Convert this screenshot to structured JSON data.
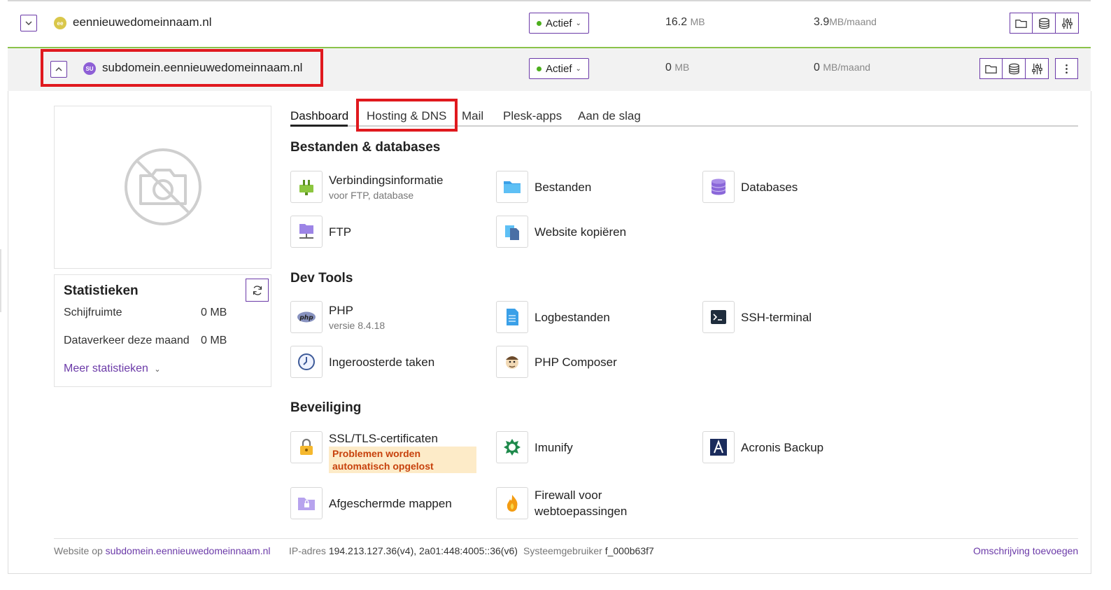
{
  "domains": [
    {
      "name": "eennieuwedomeinnaam.nl",
      "icon_text": "ee",
      "icon_color": "#d9c74a",
      "status": "Actief",
      "disk_value": "16.2",
      "disk_unit": "MB",
      "traffic_value": "3.9",
      "traffic_unit": "MB/maand"
    },
    {
      "name": "subdomein.eennieuwedomeinnaam.nl",
      "icon_text": "SU",
      "icon_color": "#8e5fd6",
      "status": "Actief",
      "disk_value": "0",
      "disk_unit": "MB",
      "traffic_value": "0",
      "traffic_unit": "MB/maand"
    }
  ],
  "stats": {
    "title": "Statistieken",
    "disk_label": "Schijfruimte",
    "disk_value": "0 MB",
    "traffic_label": "Dataverkeer deze maand",
    "traffic_value": "0 MB",
    "more_link": "Meer statistieken"
  },
  "tabs": [
    "Dashboard",
    "Hosting & DNS",
    "Mail",
    "Plesk-apps",
    "Aan de slag"
  ],
  "active_tab": "Dashboard",
  "sections": {
    "files": {
      "title": "Bestanden & databases",
      "items": [
        {
          "label": "Verbindingsinformatie",
          "sub": "voor FTP, database",
          "icon": "plug-icon"
        },
        {
          "label": "Bestanden",
          "icon": "folder-icon"
        },
        {
          "label": "Databases",
          "icon": "database-icon"
        },
        {
          "label": "FTP",
          "icon": "ftp-folder-icon"
        },
        {
          "label": "Website kopiëren",
          "icon": "copy-website-icon"
        }
      ]
    },
    "dev": {
      "title": "Dev Tools",
      "items": [
        {
          "label": "PHP",
          "sub": "versie 8.4.18",
          "icon": "php-icon"
        },
        {
          "label": "Logbestanden",
          "icon": "log-file-icon"
        },
        {
          "label": "SSH-terminal",
          "icon": "terminal-icon"
        },
        {
          "label": "Ingeroosterde taken",
          "icon": "clock-icon"
        },
        {
          "label": "PHP Composer",
          "icon": "composer-icon"
        }
      ]
    },
    "security": {
      "title": "Beveiliging",
      "items": [
        {
          "label": "SSL/TLS-certificaten",
          "warning": "Problemen worden automatisch opgelost",
          "icon": "lock-icon"
        },
        {
          "label": "Imunify",
          "icon": "imunify-icon"
        },
        {
          "label": "Acronis Backup",
          "icon": "acronis-icon"
        },
        {
          "label": "Afgeschermde mappen",
          "icon": "protected-folder-icon"
        },
        {
          "label": "Firewall voor webtoepassingen",
          "icon": "flame-icon"
        }
      ]
    }
  },
  "footer": {
    "website_label": "Website op",
    "website_link": "subdomein.eennieuwedomeinnaam.nl",
    "ip_label": "IP-adres",
    "ip_value": "194.213.127.36(v4), 2a01:448:4005::36(v6)",
    "user_label": "Systeemgebruiker",
    "user_value": "f_000b63f7",
    "description_link": "Omschrijving toevoegen"
  },
  "colors": {
    "accent": "#6b3aa8",
    "active_green": "#4caf1c",
    "highlight_red": "#e0191e",
    "warning_bg": "#fdebc8",
    "warning_text": "#c7410c"
  }
}
